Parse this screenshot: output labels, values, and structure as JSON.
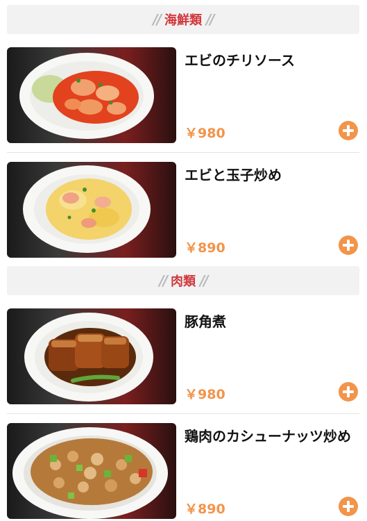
{
  "sections": [
    {
      "title": "海鮮類",
      "items": [
        {
          "name": "エビのチリソース",
          "price": "￥980",
          "image": "shrimp-chili-sauce-photo"
        },
        {
          "name": "エビと玉子炒め",
          "price": "￥890",
          "image": "shrimp-egg-stirfry-photo"
        }
      ]
    },
    {
      "title": "肉類",
      "items": [
        {
          "name": "豚角煮",
          "price": "￥980",
          "image": "braised-pork-belly-photo"
        },
        {
          "name": "鶏肉のカシューナッツ炒め",
          "price": "￥890",
          "image": "chicken-cashew-stirfry-photo"
        }
      ]
    }
  ],
  "colors": {
    "accent": "#f2944a",
    "section_title": "#d1383d",
    "section_bg": "#f2f2f2"
  },
  "icons": {
    "add": "plus-circle-icon"
  }
}
